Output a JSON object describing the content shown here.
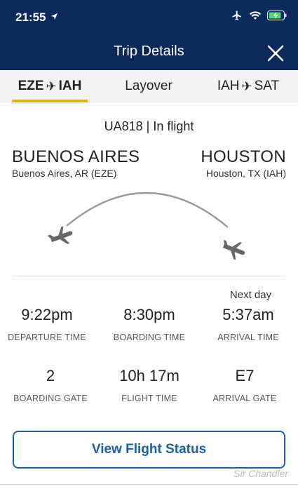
{
  "status_bar": {
    "time": "21:55",
    "location_icon": "location-arrow-icon",
    "icons": [
      "airplane-mode-icon",
      "wifi-icon",
      "battery-charging-icon"
    ]
  },
  "header": {
    "title": "Trip Details",
    "close_icon": "close-icon"
  },
  "tabs": [
    {
      "from": "EZE",
      "to": "IAH",
      "active": true
    },
    {
      "label": "Layover"
    },
    {
      "from": "IAH",
      "to": "SAT"
    }
  ],
  "flight": {
    "status_line": "UA818 | In flight"
  },
  "origin": {
    "city": "BUENOS AIRES",
    "detail": "Buenos Aires, AR (EZE)"
  },
  "destination": {
    "city": "HOUSTON",
    "detail": "Houston, TX (IAH)"
  },
  "times": {
    "next_day_note": "Next day",
    "departure": {
      "value": "9:22pm",
      "label": "DEPARTURE TIME"
    },
    "boarding": {
      "value": "8:30pm",
      "label": "BOARDING TIME"
    },
    "arrival": {
      "value": "5:37am",
      "label": "ARRIVAL TIME"
    }
  },
  "gates": {
    "boarding_gate": {
      "value": "2",
      "label": "BOARDING GATE"
    },
    "flight_time": {
      "value": "10h 17m",
      "label": "FLIGHT TIME"
    },
    "arrival_gate": {
      "value": "E7",
      "label": "ARRIVAL GATE"
    }
  },
  "actions": {
    "view_status": "View Flight Status"
  },
  "watermark": "Sir Chandler",
  "colors": {
    "header_bg": "#0b2a5b",
    "tab_accent": "#e6b20a",
    "button_blue": "#1a5fa8"
  }
}
